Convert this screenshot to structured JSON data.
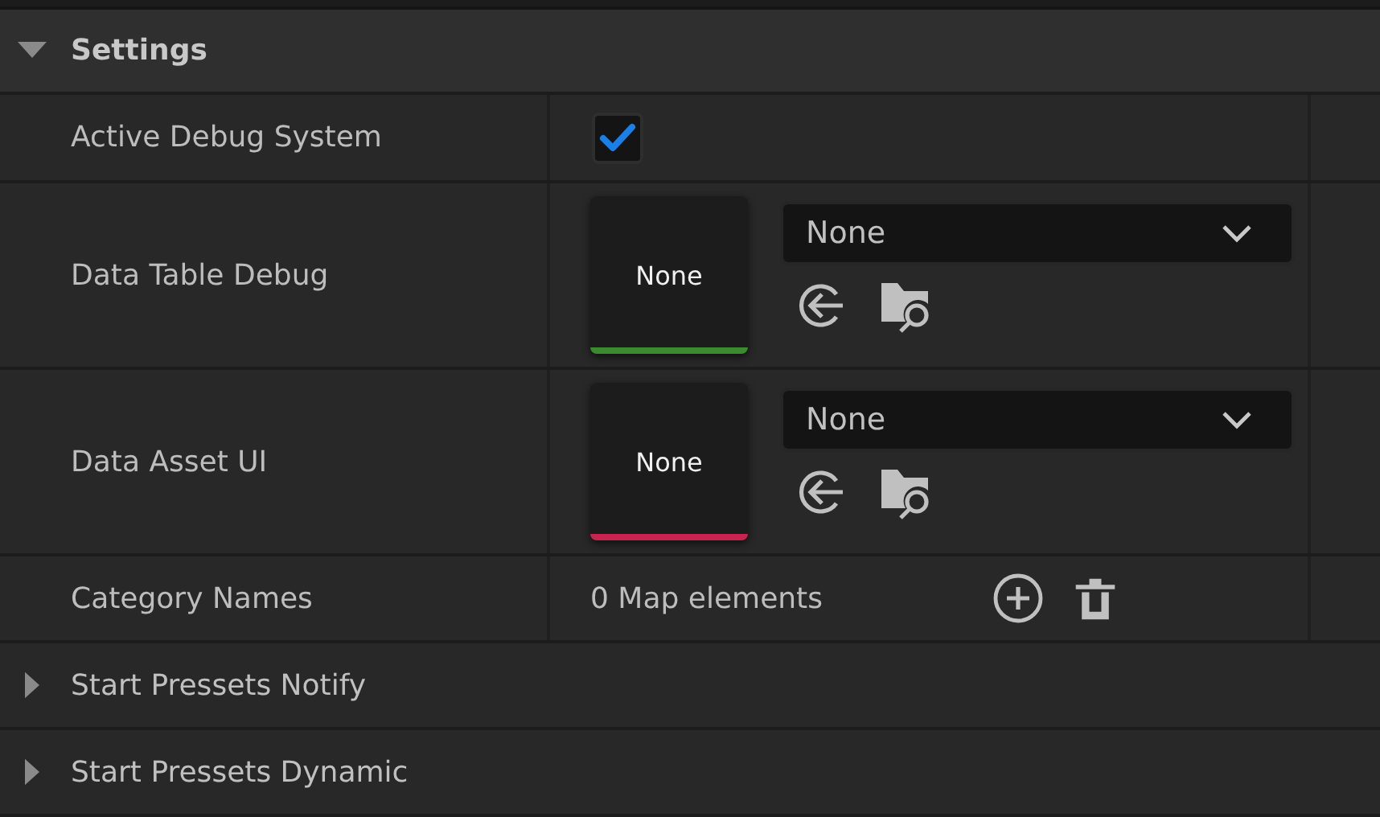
{
  "section": {
    "title": "Settings",
    "expanded": true
  },
  "properties": [
    {
      "kind": "checkbox",
      "label": "Active Debug System",
      "checked": true
    },
    {
      "kind": "asset",
      "label": "Data Table Debug",
      "thumbnail": "None",
      "color": "#3a8a2e",
      "value": "None"
    },
    {
      "kind": "asset",
      "label": "Data Asset UI",
      "thumbnail": "None",
      "color": "#c8244f",
      "value": "None"
    },
    {
      "kind": "map",
      "label": "Category Names",
      "value": "0 Map elements"
    }
  ],
  "sections": [
    {
      "title": "Start Pressets Notify",
      "expanded": false
    },
    {
      "title": "Start Pressets Dynamic",
      "expanded": false
    }
  ]
}
